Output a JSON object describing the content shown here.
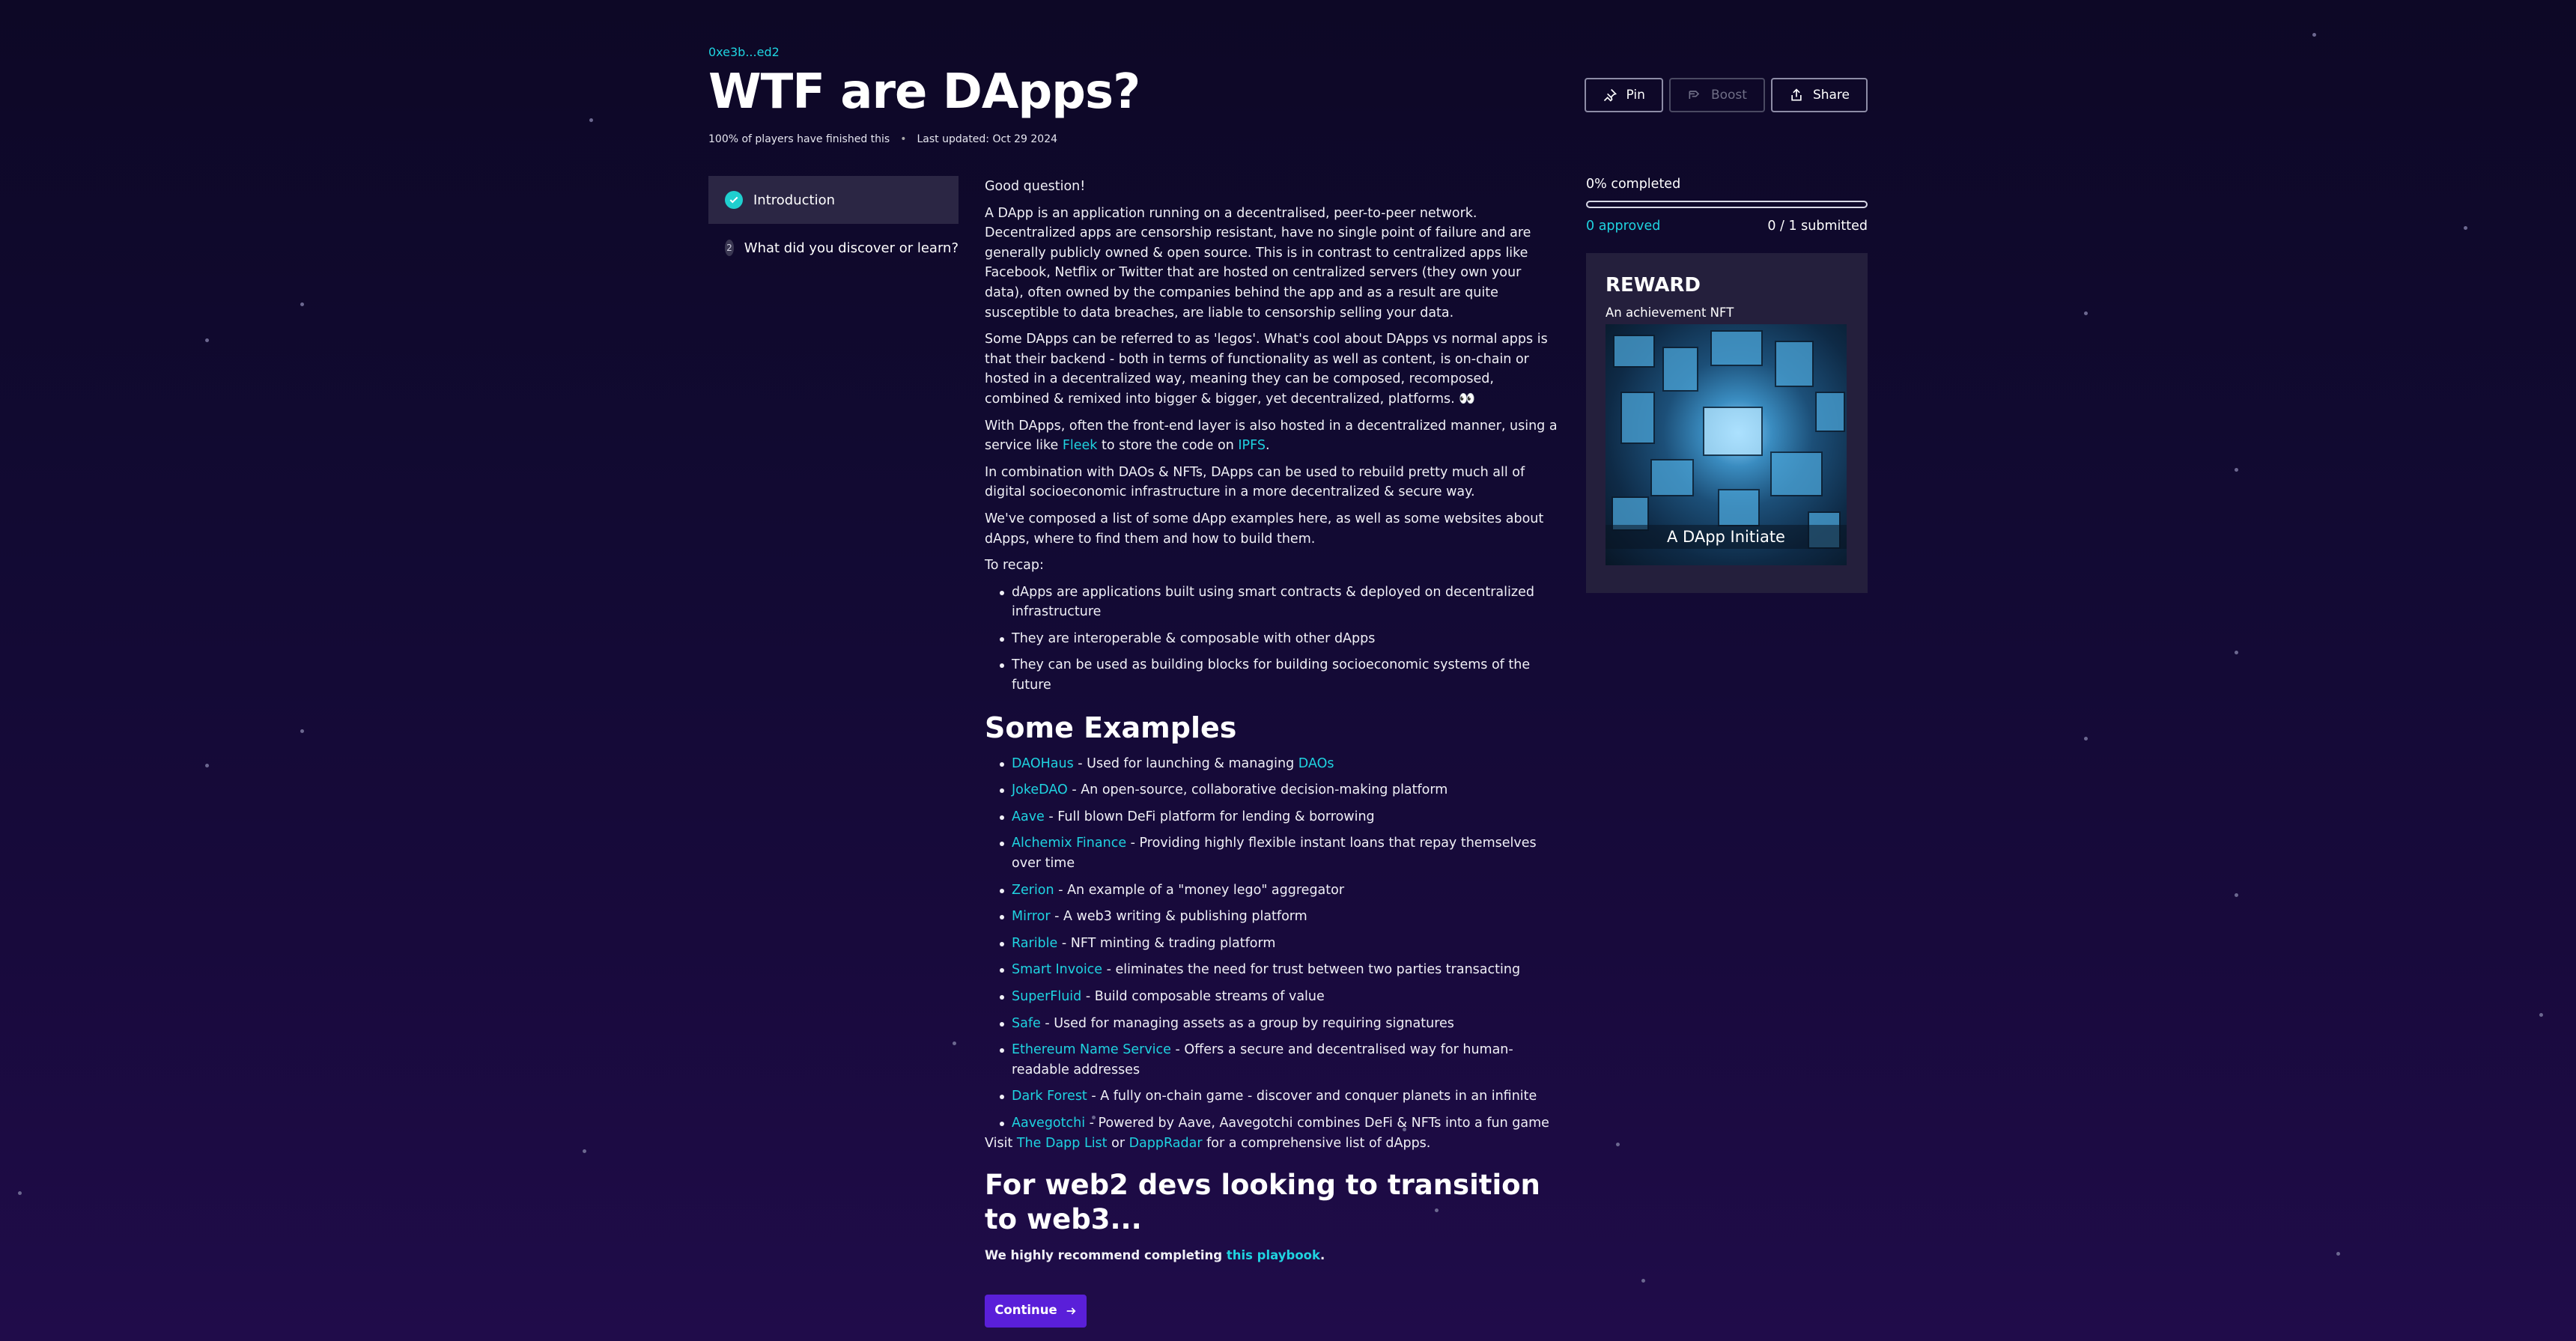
{
  "header": {
    "author": "0xe3b...ed2",
    "title": "WTF are DApps?",
    "finished": "100% of players have finished this",
    "separator": "•",
    "updated": "Last updated: Oct 29 2024"
  },
  "actions": {
    "pin": "Pin",
    "boost": "Boost",
    "share": "Share"
  },
  "sidebar": {
    "items": [
      {
        "label": "Introduction",
        "state": "completed"
      },
      {
        "label": "What did you discover or learn?",
        "number": "2"
      }
    ]
  },
  "content": {
    "p1": "Good question!",
    "p2": "A DApp is an application running on a decentralised, peer-to-peer network. Decentralized apps are censorship resistant, have no single point of failure and are generally publicly owned & open source. This is in contrast to centralized apps like Facebook, Netflix or Twitter that are hosted on centralized servers (they own your data), often owned by the companies behind the app and as a result are quite susceptible to data breaches, are liable to censorship selling your data.",
    "p3": "Some DApps can be referred to as 'legos'. What's cool about DApps vs normal apps is that their backend - both in terms of functionality as well as content, is on-chain or hosted in a decentralized way, meaning they can be composed, recomposed, combined & remixed into bigger & bigger, yet decentralized, platforms. 👀",
    "p4_pre": "With DApps, often the front-end layer is also hosted in a decentralized manner, using a service like ",
    "p4_link1": "Fleek",
    "p4_mid": " to store the code on ",
    "p4_link2": "IPFS",
    "p4_post": ".",
    "p5": "In combination with DAOs & NFTs, DApps can be used to rebuild pretty much all of digital socioeconomic infrastructure in a more decentralized & secure way.",
    "p6": "We've composed a list of some dApp examples here, as well as some websites about dApps, where to find them and how to build them.",
    "recap_title": "To recap:",
    "recap": [
      "dApps are applications built using smart contracts & deployed on decentralized infrastructure",
      "They are interoperable & composable with other dApps",
      "They can be used as building blocks for building socioeconomic systems of the future"
    ],
    "examples_heading": "Some Examples",
    "examples": [
      {
        "name": "DAOHaus",
        "desc": " - Used for launching & managing ",
        "extra_link": "DAOs"
      },
      {
        "name": "JokeDAO",
        "desc": " - An open-source, collaborative decision-making platform"
      },
      {
        "name": "Aave",
        "desc": " - Full blown DeFi platform for lending & borrowing"
      },
      {
        "name": "Alchemix Finance",
        "desc": " - Providing highly flexible instant loans that repay themselves over time"
      },
      {
        "name": "Zerion",
        "desc": " - An example of a \"money lego\" aggregator"
      },
      {
        "name": "Mirror",
        "desc": " - A web3 writing & publishing platform"
      },
      {
        "name": "Rarible",
        "desc": " - NFT minting & trading platform"
      },
      {
        "name": "Smart Invoice",
        "desc": " - eliminates the need for trust between two parties transacting"
      },
      {
        "name": "SuperFluid",
        "desc": " - Build composable streams of value"
      },
      {
        "name": "Safe",
        "desc": " - Used for managing assets as a group by requiring signatures"
      },
      {
        "name": "Ethereum Name Service",
        "desc": " - Offers a secure and decentralised way for human-readable addresses"
      },
      {
        "name": "Dark Forest",
        "desc": " - A fully on-chain game - discover and conquer planets in an infinite"
      },
      {
        "name": "Aavegotchi",
        "desc": " - Powered by Aave, Aavegotchi combines DeFi & NFTs into a fun game"
      }
    ],
    "visit_pre": "Visit ",
    "visit_link1": "The Dapp List",
    "visit_mid": " or ",
    "visit_link2": "DappRadar",
    "visit_post": " for a comprehensive list of dApps.",
    "web2_heading": "For web2 devs looking to transition to web3...",
    "recommend_pre": "We highly recommend completing ",
    "recommend_link": "this playbook",
    "recommend_post": ".",
    "continue": "Continue"
  },
  "progress": {
    "label": "0% completed",
    "value": 0,
    "approved": "0 approved",
    "submitted": "0 / 1 submitted"
  },
  "reward": {
    "title": "REWARD",
    "subtitle": "An achievement NFT",
    "nft_caption": "A DApp Initiate"
  },
  "colors": {
    "accent": "#1fd3e0",
    "button": "#5a1fd9",
    "author": "#9c8cf0"
  }
}
